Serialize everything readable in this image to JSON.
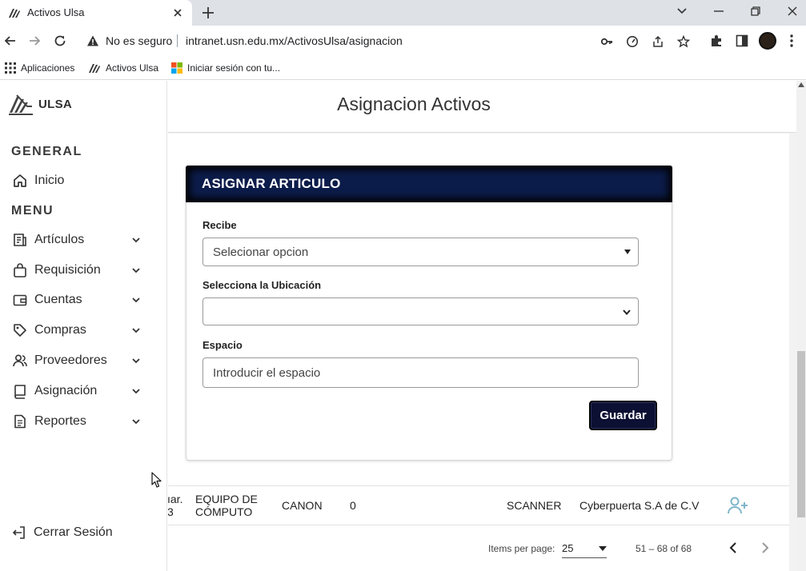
{
  "browser": {
    "tab_title": "Activos Ulsa",
    "omnibox_security": "No es seguro",
    "omnibox_url": "intranet.usn.edu.mx/ActivosUlsa/asignacion",
    "bookmarks": [
      "Aplicaciones",
      "Activos Ulsa",
      "Iniciar sesión con tu..."
    ]
  },
  "sidebar": {
    "logo_text": "ULSA",
    "general_heading": "GENERAL",
    "home_label": "Inicio",
    "menu_heading": "MENU",
    "menu_items": [
      {
        "label": "Artículos",
        "icon": "articles-icon"
      },
      {
        "label": "Requisición",
        "icon": "bag-icon"
      },
      {
        "label": "Cuentas",
        "icon": "wallet-icon"
      },
      {
        "label": "Compras",
        "icon": "tag-icon"
      },
      {
        "label": "Proveedores",
        "icon": "users-icon"
      },
      {
        "label": "Asignación",
        "icon": "book-icon"
      },
      {
        "label": "Reportes",
        "icon": "document-icon"
      }
    ],
    "logout_label": "Cerrar Sesión"
  },
  "page": {
    "title": "Asignacion Activos"
  },
  "form": {
    "header": "ASIGNAR ARTICULO",
    "recibe_label": "Recibe",
    "recibe_value": "Selecionar opcion",
    "ubicacion_label": "Selecciona la Ubicación",
    "ubicacion_value": "",
    "espacio_label": "Espacio",
    "espacio_placeholder": "Introducir el espacio",
    "save_label": "Guardar"
  },
  "table_row": {
    "col_partial_line1": "ıar.",
    "col_partial_line2": "3",
    "category_line1": "EQUIPO DE",
    "category_line2": "CÓMPUTO",
    "brand": "CANON",
    "quantity": "0",
    "type": "SCANNER",
    "supplier": "Cyberpuerta S.A de C.V"
  },
  "paginator": {
    "items_per_page_label": "Items per page:",
    "page_size": "25",
    "range": "51 – 68 of 68"
  }
}
